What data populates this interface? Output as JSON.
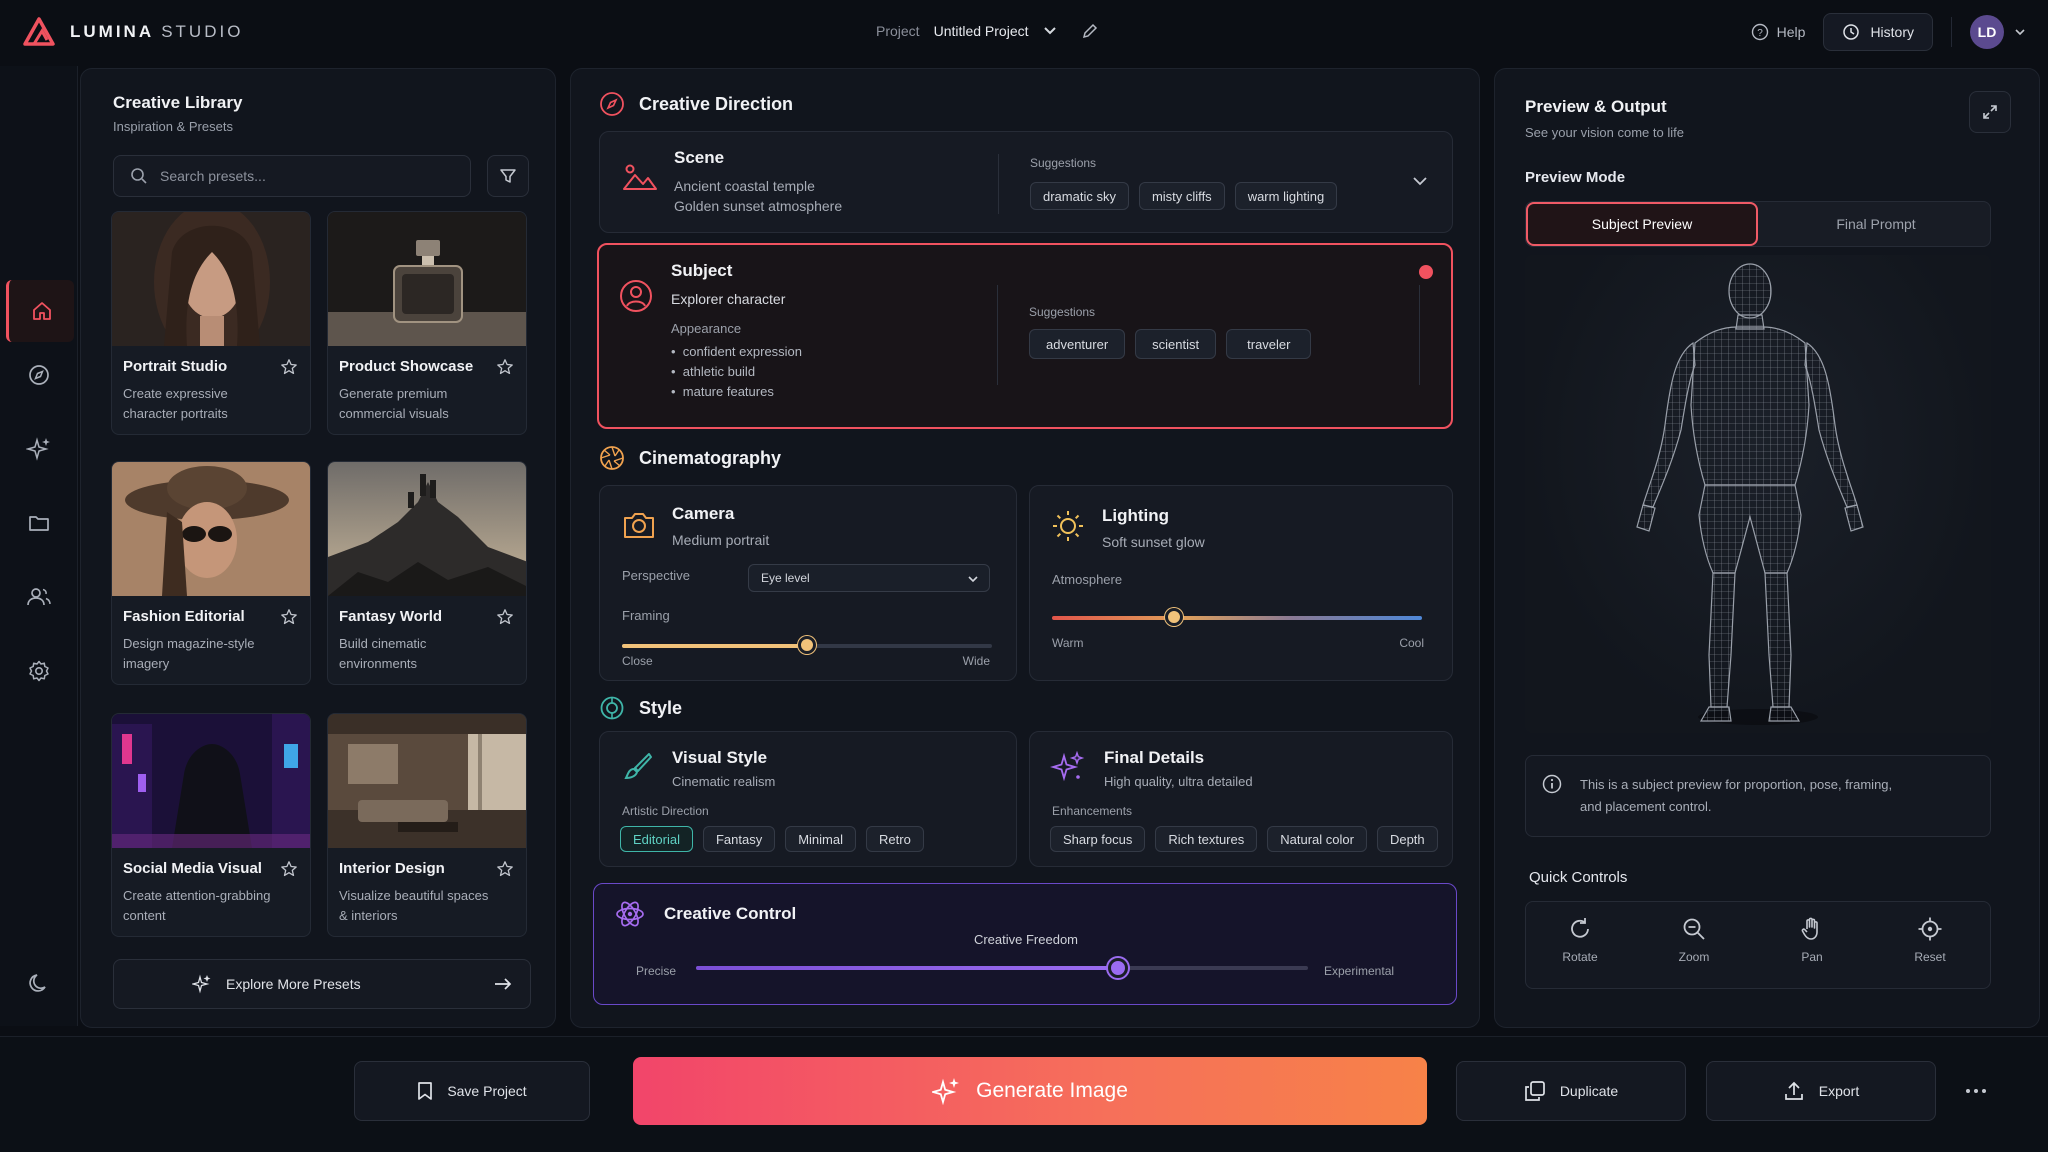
{
  "app": {
    "brand_bold": "LUMINA",
    "brand_light": "STUDIO",
    "accent": "#f0525f"
  },
  "header": {
    "project_label": "Project",
    "project_name": "Untitled Project",
    "help_label": "Help",
    "history_label": "History",
    "avatar_initials": "LD"
  },
  "rail": {
    "items": [
      "home-icon",
      "compass-icon",
      "sparkles-icon",
      "folder-icon",
      "users-icon",
      "gear-icon"
    ],
    "bottom": "moon-icon"
  },
  "library": {
    "title": "Creative Library",
    "subtitle": "Inspiration & Presets",
    "search_placeholder": "Search presets...",
    "presets": [
      {
        "title": "Portrait Studio",
        "desc": "Create expressive character portraits"
      },
      {
        "title": "Product Showcase",
        "desc": "Generate premium commercial visuals"
      },
      {
        "title": "Fashion Editorial",
        "desc": "Design magazine-style imagery"
      },
      {
        "title": "Fantasy World",
        "desc": "Build cinematic environments"
      },
      {
        "title": "Social Media Visual",
        "desc": "Create attention-grabbing content"
      },
      {
        "title": "Interior Design",
        "desc": "Visualize beautiful spaces & interiors"
      }
    ],
    "explore_label": "Explore More Presets"
  },
  "direction": {
    "title": "Creative Direction",
    "scene": {
      "title": "Scene",
      "line1": "Ancient coastal temple",
      "line2": "Golden sunset atmosphere",
      "suggestions_label": "Suggestions",
      "suggestions": [
        "dramatic sky",
        "misty cliffs",
        "warm lighting"
      ]
    },
    "subject": {
      "title": "Subject",
      "line1": "Explorer character",
      "appearance_label": "Appearance",
      "bullets": [
        "confident expression",
        "athletic build",
        "mature features"
      ],
      "suggestions_label": "Suggestions",
      "suggestions": [
        "adventurer",
        "scientist",
        "traveler"
      ]
    }
  },
  "cinematography": {
    "title": "Cinematography",
    "camera": {
      "title": "Camera",
      "sub": "Medium portrait",
      "perspective_label": "Perspective",
      "perspective_value": "Eye level",
      "framing_label": "Framing",
      "framing_min": "Close",
      "framing_max": "Wide",
      "framing_value": 0.5
    },
    "lighting": {
      "title": "Lighting",
      "sub": "Soft sunset glow",
      "atmosphere_label": "Atmosphere",
      "min": "Warm",
      "max": "Cool",
      "value": 0.33
    }
  },
  "style": {
    "title": "Style",
    "visual": {
      "title": "Visual Style",
      "sub": "Cinematic realism",
      "direction_label": "Artistic Direction",
      "options": [
        "Editorial",
        "Fantasy",
        "Minimal",
        "Retro"
      ],
      "selected": "Editorial"
    },
    "details": {
      "title": "Final Details",
      "sub": "High quality, ultra detailed",
      "enh_label": "Enhancements",
      "options": [
        "Sharp focus",
        "Rich textures",
        "Natural color",
        "Depth"
      ]
    }
  },
  "control": {
    "title": "Creative Control",
    "freedom_label": "Creative Freedom",
    "min": "Precise",
    "max": "Experimental",
    "value": 0.69
  },
  "preview": {
    "title": "Preview & Output",
    "subtitle": "See your vision come to life",
    "mode_label": "Preview Mode",
    "tabs": [
      "Subject Preview",
      "Final Prompt"
    ],
    "active_tab": "Subject Preview",
    "info": "This is a subject preview for proportion, pose, framing, and placement control.",
    "quick_label": "Quick Controls",
    "quick": [
      "Rotate",
      "Zoom",
      "Pan",
      "Reset"
    ]
  },
  "footer": {
    "save": "Save Project",
    "generate": "Generate Image",
    "duplicate": "Duplicate",
    "export": "Export"
  }
}
